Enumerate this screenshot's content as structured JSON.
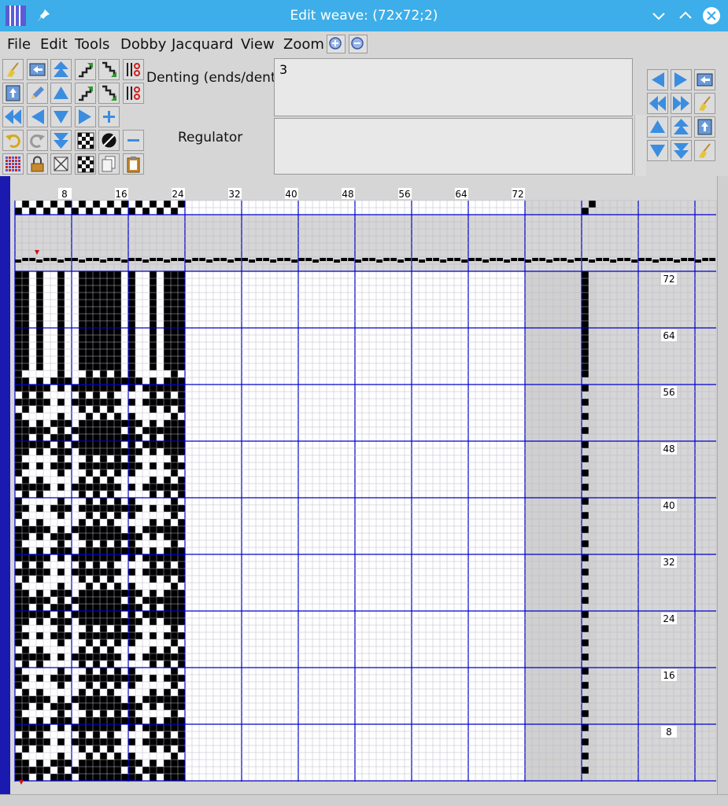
{
  "window": {
    "title": "Edit weave: (72x72;2)"
  },
  "menu": [
    "File",
    "Edit",
    "Tools",
    "Dobby",
    "Jacquard",
    "View",
    "Zoom"
  ],
  "fields": {
    "denting_label": "Denting (ends/dent)",
    "denting_value": "3",
    "regulator_label": "Regulator",
    "regulator_value": ""
  },
  "ruler": {
    "top_labels": [
      "8",
      "16",
      "24",
      "32",
      "40",
      "48",
      "56",
      "64",
      "72"
    ],
    "side_labels": [
      "72",
      "64",
      "56",
      "48",
      "40",
      "32",
      "24",
      "16",
      "8"
    ]
  },
  "colors": {
    "titlebar": "#3daee9",
    "grid_line": "#0000cc",
    "cell_fill": "#000000"
  }
}
